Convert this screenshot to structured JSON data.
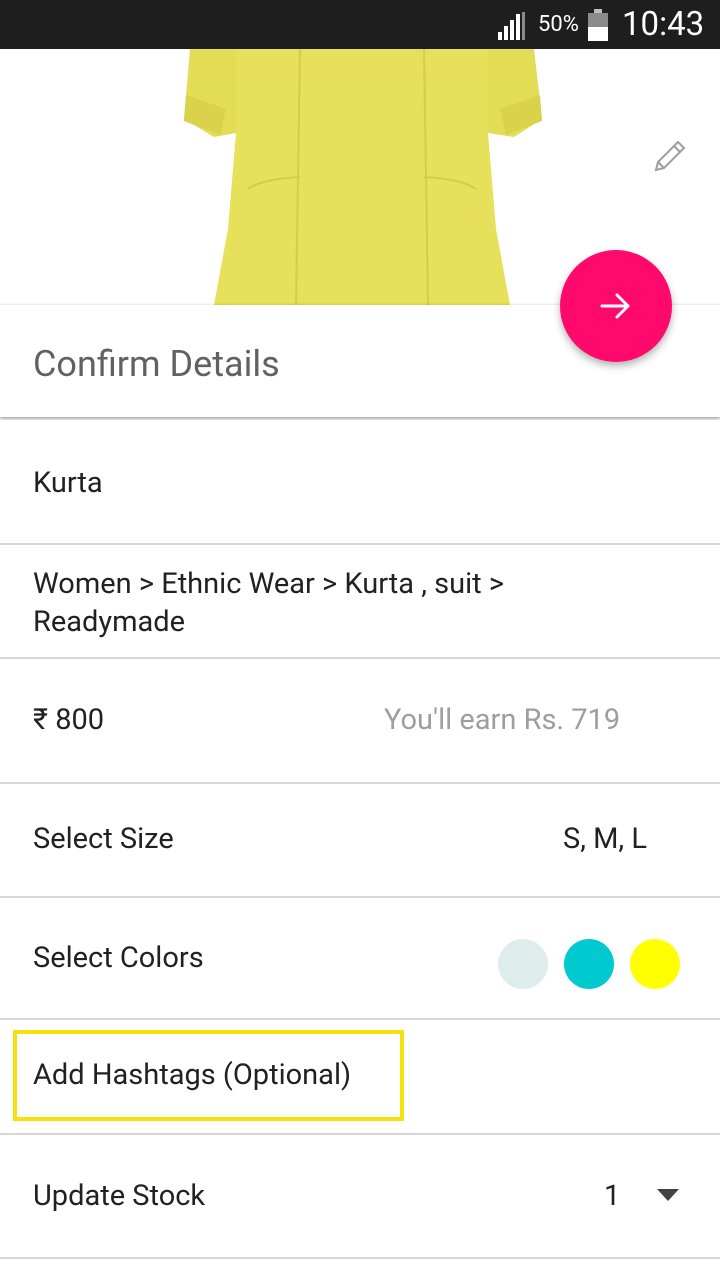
{
  "status_bar": {
    "battery_percent": "50%",
    "time": "10:43",
    "signal_icon": "signal-icon",
    "battery_icon": "battery-icon"
  },
  "product_image": {
    "edit_icon": "pencil-icon",
    "garment_color": "#e6e05a"
  },
  "header": {
    "title": "Confirm Details",
    "next_button_icon": "arrow-right-icon",
    "next_button_color": "#ff0a6c"
  },
  "details": {
    "title": "Kurta",
    "category": "Women > Ethnic Wear > Kurta , suit > Readymade",
    "price": "₹ 800",
    "earn_text": "You'll earn Rs. 719",
    "info_icon": "info-icon",
    "size_label": "Select Size",
    "size_value": "S, M, L",
    "colors_label": "Select Colors",
    "colors": [
      "#dfecec",
      "#00c9cf",
      "#ffff00"
    ],
    "hashtags_label": "Add Hashtags (Optional)",
    "highlight_color": "#f5e10b",
    "stock_label": "Update Stock",
    "stock_value": "1",
    "stock_dropdown_icon": "dropdown-arrow-icon"
  }
}
